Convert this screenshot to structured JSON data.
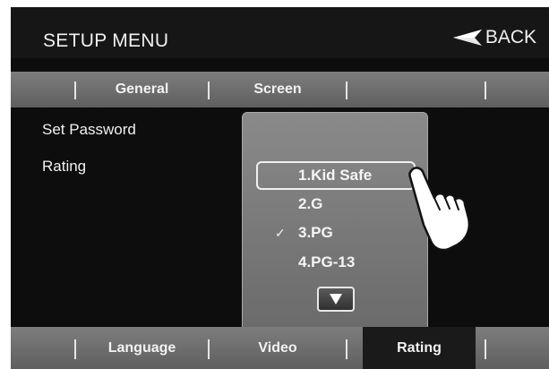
{
  "header": {
    "title": "SETUP MENU",
    "back_label": "BACK"
  },
  "top_tabs": [
    "General",
    "Screen"
  ],
  "settings": [
    "Set Password",
    "Rating"
  ],
  "rating_options": [
    {
      "label": "1.Kid Safe",
      "highlighted": true,
      "checked": false
    },
    {
      "label": "2.G",
      "highlighted": false,
      "checked": false
    },
    {
      "label": "3.PG",
      "highlighted": false,
      "checked": true
    },
    {
      "label": "4.PG-13",
      "highlighted": false,
      "checked": false
    }
  ],
  "check_mark": "✓",
  "bottom_tabs": [
    "Language",
    "Video",
    "Rating"
  ],
  "active_bottom_tab": "Rating",
  "colors": {
    "background": "#0d0d0d",
    "tab_bar": "#6e6e6e",
    "panel": "#7a7a7a",
    "text": "#f0f0f0"
  }
}
